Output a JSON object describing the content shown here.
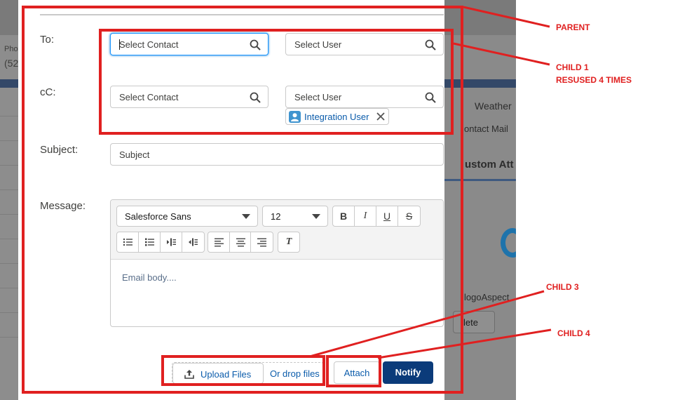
{
  "background": {
    "left_text": [
      "Pho",
      "(52"
    ],
    "right_text": {
      "weather": "Weather",
      "contact_mail": "ontact Mail",
      "custom_att": "ustom Att",
      "logo_aspect": "logoAspect",
      "delete": "lete"
    }
  },
  "form": {
    "to_label": "To:",
    "cc_label": "cC:",
    "subject_label": "Subject:",
    "message_label": "Message:",
    "to_contact_placeholder": "Select Contact",
    "to_user_placeholder": "Select User",
    "cc_contact_placeholder": "Select Contact",
    "cc_user_placeholder": "Select User",
    "cc_selected_pill": "Integration User",
    "subject_placeholder": "Subject"
  },
  "editor": {
    "font_family": "Salesforce Sans",
    "font_size": "12",
    "bold": "B",
    "italic": "I",
    "underline": "U",
    "strike": "S",
    "clear": "T",
    "body_placeholder": "Email body...."
  },
  "footer": {
    "upload_label": "Upload Files",
    "drop_label": "Or drop files",
    "attach_label": "Attach",
    "notify_label": "Notify"
  },
  "annotations": {
    "parent": "PARENT",
    "child1_line1": "CHILD 1",
    "child1_line2": "RESUSED 4 TIMES",
    "child3": "CHILD 3",
    "child4": "CHILD 4"
  },
  "colors": {
    "annotation_red": "#e02020",
    "brand_blue": "#0b3b7a",
    "link_blue": "#0b5cab",
    "focus_blue": "#1b96ff"
  }
}
